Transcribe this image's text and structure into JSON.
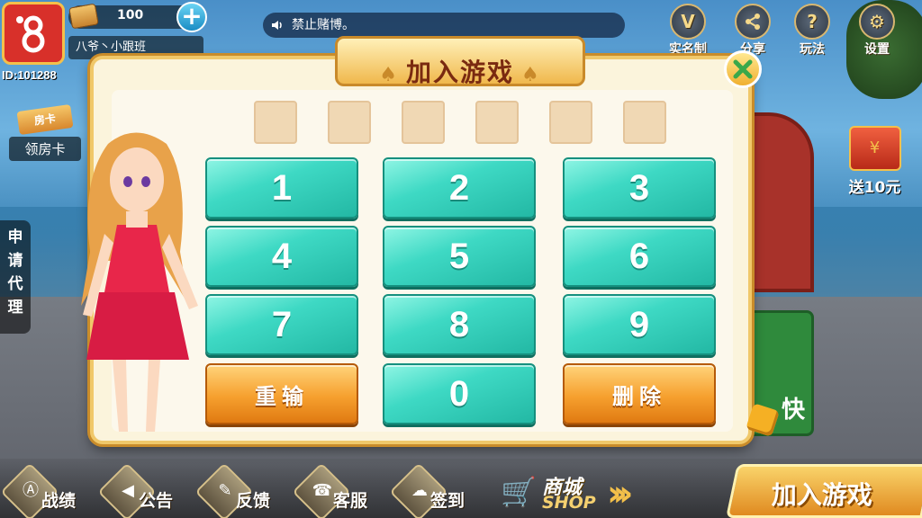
{
  "topbar": {
    "user_id": "ID:101288",
    "room_card_count": "100",
    "room_card_tag": "房卡",
    "nickname": "八爷丶小跟班",
    "notice": "禁止赌博。",
    "icons": [
      {
        "label": "实名制",
        "icon": "vip-icon",
        "glyph": "V"
      },
      {
        "label": "分享",
        "icon": "share-icon",
        "glyph": "⟨"
      },
      {
        "label": "玩法",
        "icon": "help-icon",
        "glyph": "?"
      },
      {
        "label": "设置",
        "icon": "gear-icon",
        "glyph": "⚙"
      }
    ]
  },
  "left": {
    "room_card_tag": "房卡",
    "room_card_label": "领房卡",
    "agent_label": "申请代理"
  },
  "right": {
    "redpack_label": "送10元",
    "redpack_glyph": "¥",
    "behind_text": "快"
  },
  "dialog": {
    "title": "加入游戏",
    "room_digits": [
      "",
      "",
      "",
      "",
      "",
      ""
    ],
    "keys": [
      "1",
      "2",
      "3",
      "4",
      "5",
      "6",
      "7",
      "8",
      "9",
      "重输",
      "0",
      "删除"
    ]
  },
  "bottombar": {
    "buttons": [
      {
        "label": "战绩",
        "icon": "record-icon",
        "glyph": "Ⓐ"
      },
      {
        "label": "公告",
        "icon": "announcement-icon",
        "glyph": "◀"
      },
      {
        "label": "反馈",
        "icon": "feedback-icon",
        "glyph": "✎"
      },
      {
        "label": "客服",
        "icon": "customer-service-icon",
        "glyph": "☎"
      },
      {
        "label": "签到",
        "icon": "checkin-icon",
        "glyph": "☁"
      }
    ],
    "shop_cn": "商城",
    "shop_en": "SHOP",
    "join_label": "加入游戏"
  },
  "colors": {
    "accent": "#f0c86a",
    "key_teal": "#3ed9c4",
    "key_orange": "#f6a02e"
  }
}
